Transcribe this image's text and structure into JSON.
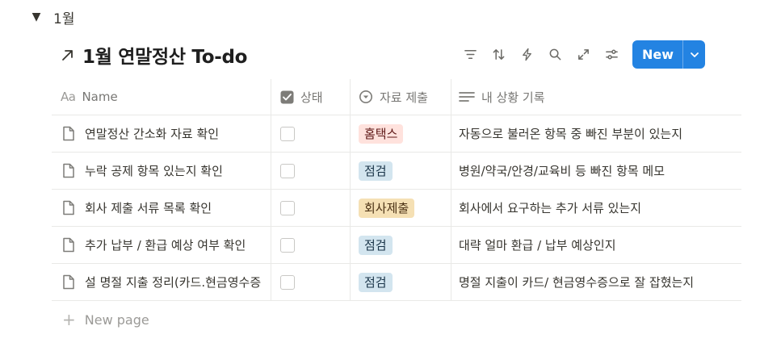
{
  "group": {
    "toggle_glyph": "▼",
    "label": "1월"
  },
  "database": {
    "title": "1월 연말정산 To-do"
  },
  "toolbar": {
    "icons": [
      "filter-icon",
      "sort-icon",
      "automation-icon",
      "search-icon",
      "expand-icon",
      "settings-icon"
    ],
    "new_label": "New"
  },
  "columns": [
    {
      "label": "Name",
      "icon": "text-property-icon",
      "icon_text": "Aa"
    },
    {
      "label": "상태",
      "icon": "checkbox-property-icon"
    },
    {
      "label": "자료 제출",
      "icon": "select-property-icon"
    },
    {
      "label": "내 상황 기록",
      "icon": "text-lines-icon"
    }
  ],
  "rows": [
    {
      "name": "연말정산 간소화 자료 확인",
      "checked": false,
      "source": "홈택스",
      "source_color": "red",
      "note": "자동으로 불러온 항목 중 빠진 부분이 있는지"
    },
    {
      "name": "누락 공제 항목 있는지 확인",
      "checked": false,
      "source": "점검",
      "source_color": "blue",
      "note": "병원/약국/안경/교육비 등 빠진 항목 메모"
    },
    {
      "name": "회사 제출 서류 목록 확인",
      "checked": false,
      "source": "회사제출",
      "source_color": "brown",
      "note": "회사에서 요구하는 추가 서류 있는지"
    },
    {
      "name": "추가 납부 / 환급 예상 여부 확인",
      "checked": false,
      "source": "점검",
      "source_color": "blue",
      "note": "대략 얼마 환급 / 납부 예상인지"
    },
    {
      "name": "설 명절 지출 정리(카드.현금영수증",
      "checked": false,
      "source": "점검",
      "source_color": "blue",
      "note": "명절 지출이 카드/ 현금영수증으로 잘 잡혔는지"
    }
  ],
  "new_page": {
    "label": "New page"
  },
  "colors": {
    "accent": "#2383e2",
    "tag_red": "#ffe2dd",
    "tag_blue": "#d3e5ef",
    "tag_brown": "#f5e0b4"
  }
}
